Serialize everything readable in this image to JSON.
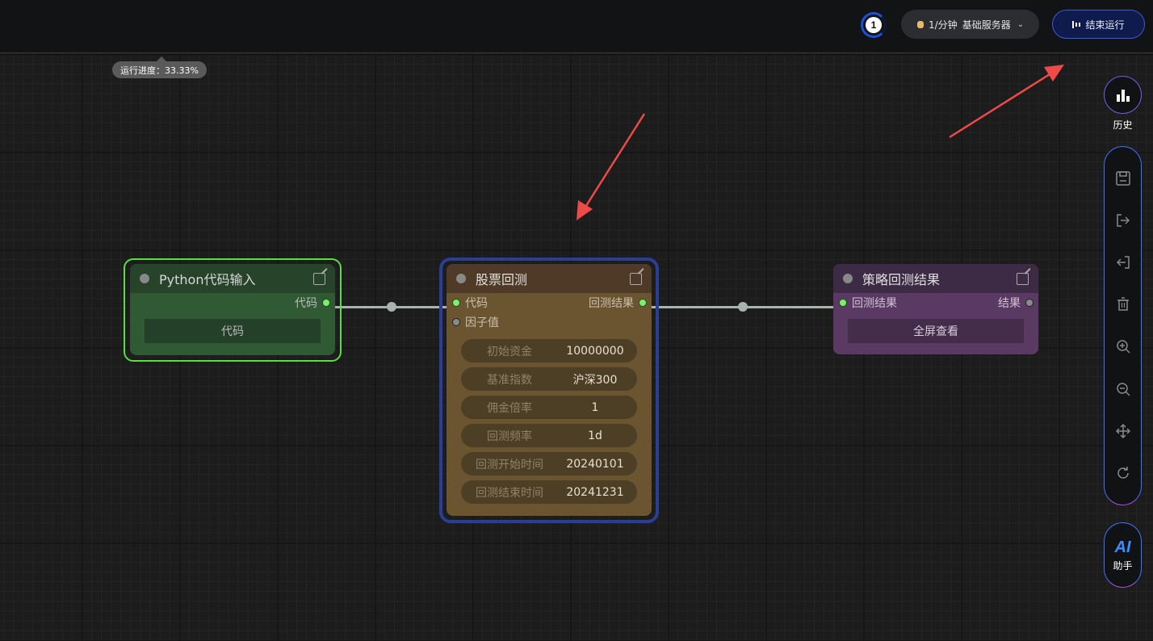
{
  "topbar": {
    "queue_count": "1",
    "server": {
      "rate": "1/分钟",
      "name": "基础服务器"
    },
    "stop_label": "结束运行"
  },
  "progress": {
    "label": "运行进度：33.33%",
    "value_percent": 33.33
  },
  "nodes": {
    "python": {
      "title": "Python代码输入",
      "output_label": "代码",
      "button": "代码"
    },
    "backtest": {
      "title": "股票回测",
      "inputs": [
        "代码",
        "因子值"
      ],
      "output_label": "回测结果",
      "params": [
        {
          "key": "初始资金",
          "value": "10000000"
        },
        {
          "key": "基准指数",
          "value": "沪深300"
        },
        {
          "key": "佣金倍率",
          "value": "1"
        },
        {
          "key": "回测频率",
          "value": "1d"
        },
        {
          "key": "回测开始时间",
          "value": "20240101"
        },
        {
          "key": "回测结束时间",
          "value": "20241231"
        }
      ]
    },
    "result": {
      "title": "策略回测结果",
      "input_label": "回测结果",
      "output_label": "结果",
      "button": "全屏查看"
    }
  },
  "sidebar": {
    "history_label": "历史",
    "tools": [
      "save-icon",
      "export-icon",
      "import-icon",
      "trash-icon",
      "zoom-in-icon",
      "zoom-out-icon",
      "move-icon",
      "refresh-icon"
    ],
    "ai_logo": "AI",
    "ai_label": "助手"
  },
  "colors": {
    "accent_blue": "#3b5bd1",
    "python_node": "#2f5a34",
    "backtest_node": "#6b5430",
    "result_node": "#5a3a63",
    "annotation_arrow": "#ef4a4a"
  }
}
